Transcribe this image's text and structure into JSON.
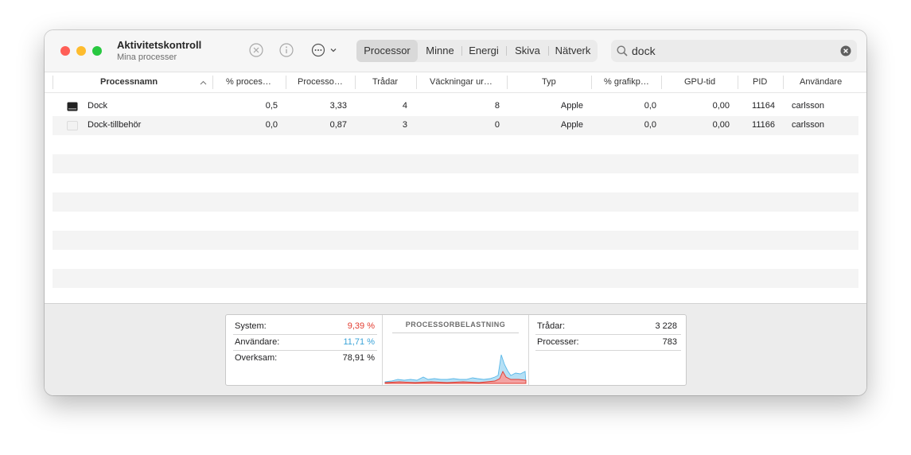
{
  "window": {
    "title": "Aktivitetskontroll",
    "subtitle": "Mina processer"
  },
  "toolbar": {
    "tabs": [
      "Processor",
      "Minne",
      "Energi",
      "Skiva",
      "Nätverk"
    ],
    "active_tab": "Processor",
    "search_value": "dock",
    "icons": [
      "stop-process-icon",
      "info-icon",
      "more-actions-icon",
      "chevron-down-icon",
      "search-icon",
      "clear-search-icon"
    ]
  },
  "table": {
    "columns": [
      "Processnamn",
      "% proces…",
      "Processo…",
      "Trådar",
      "Väckningar ur…",
      "Typ",
      "% grafikp…",
      "GPU-tid",
      "PID",
      "Användare"
    ],
    "rows": [
      {
        "name": "Dock",
        "cpu_pct": "0,5",
        "cpu_time": "3,33",
        "threads": "4",
        "wakeups": "8",
        "type": "Apple",
        "gpu_pct": "0,0",
        "gpu_time": "0,00",
        "pid": "11164",
        "user": "carlsson"
      },
      {
        "name": "Dock-tillbehör",
        "cpu_pct": "0,0",
        "cpu_time": "0,87",
        "threads": "3",
        "wakeups": "0",
        "type": "Apple",
        "gpu_pct": "0,0",
        "gpu_time": "0,00",
        "pid": "11166",
        "user": "carlsson"
      }
    ]
  },
  "stats": {
    "system_label": "System:",
    "system_value": "9,39 %",
    "user_label": "Användare:",
    "user_value": "11,71 %",
    "idle_label": "Overksam:",
    "idle_value": "78,91 %",
    "chart_title": "PROCESSORBELASTNING",
    "threads_label": "Trådar:",
    "threads_value": "3 228",
    "processes_label": "Processer:",
    "processes_value": "783"
  },
  "colors": {
    "system": "#e23b2f",
    "user": "#3aa3d8",
    "close": "#ff5f57",
    "minimize": "#febc2e",
    "zoom": "#28c840"
  }
}
